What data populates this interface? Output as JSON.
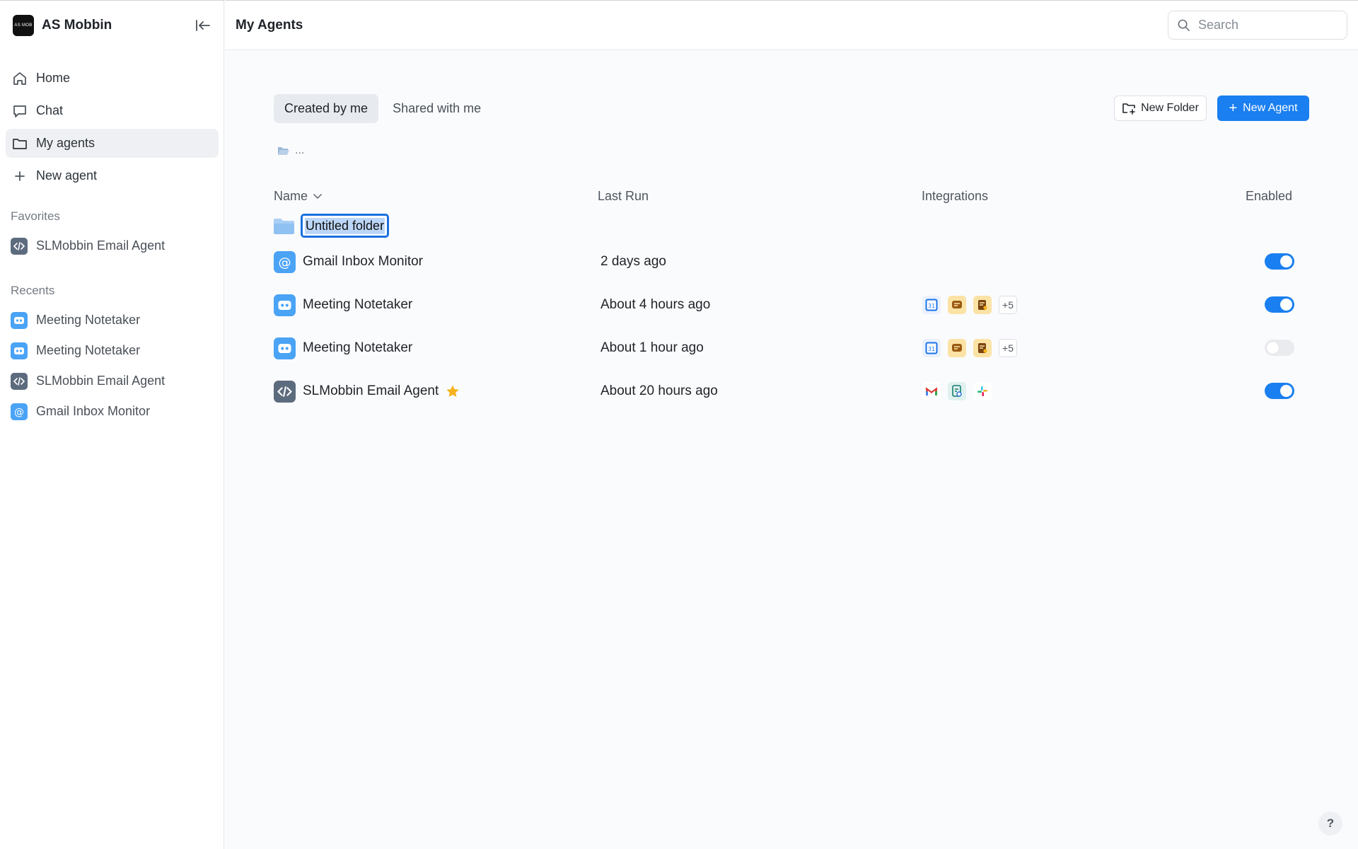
{
  "workspace": {
    "name": "AS Mobbin",
    "logo_text": "AS MOB"
  },
  "nav": {
    "home": "Home",
    "chat": "Chat",
    "my_agents": "My agents",
    "new_agent": "New agent"
  },
  "favorites": {
    "title": "Favorites",
    "items": [
      {
        "label": "SLMobbin Email Agent",
        "icon": "code-icon"
      }
    ]
  },
  "recents": {
    "title": "Recents",
    "items": [
      {
        "label": "Meeting Notetaker",
        "icon": "bot-icon"
      },
      {
        "label": "Meeting Notetaker",
        "icon": "bot-icon"
      },
      {
        "label": "SLMobbin Email Agent",
        "icon": "code-icon"
      },
      {
        "label": "Gmail Inbox Monitor",
        "icon": "at-icon"
      }
    ]
  },
  "header": {
    "title": "My Agents",
    "search_placeholder": "Search"
  },
  "tabs": {
    "created": "Created by me",
    "shared": "Shared with me"
  },
  "actions": {
    "new_folder": "New Folder",
    "new_agent": "New Agent"
  },
  "breadcrumb": {
    "text": "..."
  },
  "table": {
    "columns": {
      "name": "Name",
      "last_run": "Last Run",
      "integrations": "Integrations",
      "enabled": "Enabled"
    },
    "folder": {
      "name": "Untitled folder"
    },
    "rows": [
      {
        "name": "Gmail Inbox Monitor",
        "icon": "at-icon",
        "last_run": "2 days ago",
        "integrations": [],
        "more": "",
        "enabled": true,
        "favorite": false
      },
      {
        "name": "Meeting Notetaker",
        "icon": "bot-icon",
        "last_run": "About 4 hours ago",
        "integrations": [
          "google-calendar-icon",
          "chat-app-icon",
          "notes-app-icon"
        ],
        "more": "+5",
        "enabled": true,
        "favorite": false
      },
      {
        "name": "Meeting Notetaker",
        "icon": "bot-icon",
        "last_run": "About 1 hour ago",
        "integrations": [
          "google-calendar-icon",
          "chat-app-icon",
          "notes-app-icon"
        ],
        "more": "+5",
        "enabled": false,
        "favorite": false
      },
      {
        "name": "SLMobbin Email Agent",
        "icon": "code-icon",
        "last_run": "About 20 hours ago",
        "integrations": [
          "gmail-icon",
          "sheets-icon",
          "slack-icon"
        ],
        "more": "",
        "enabled": true,
        "favorite": true
      }
    ]
  },
  "help": {
    "label": "?"
  },
  "colors": {
    "accent": "#1a7ff0",
    "star": "#f6b21b",
    "agent_icon_blue": "#4aa3f5",
    "agent_icon_slate": "#5d6b7e"
  }
}
